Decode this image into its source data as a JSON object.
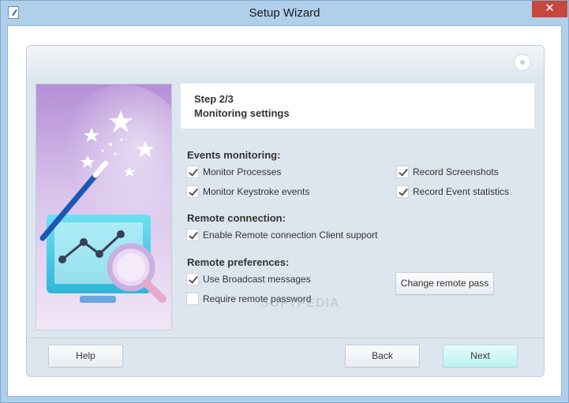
{
  "window": {
    "title": "Setup Wizard",
    "close_glyph": "✕"
  },
  "step": {
    "title": "Step 2/3",
    "subtitle": "Monitoring settings"
  },
  "events_monitoring": {
    "title": "Events monitoring:",
    "items": [
      {
        "label": "Monitor Processes",
        "checked": true
      },
      {
        "label": "Record Screenshots",
        "checked": true
      },
      {
        "label": "Monitor Keystroke events",
        "checked": true
      },
      {
        "label": "Record Event statistics",
        "checked": true
      }
    ]
  },
  "remote_connection": {
    "title": "Remote connection:",
    "items": [
      {
        "label": "Enable Remote connection Client support",
        "checked": true
      }
    ]
  },
  "remote_preferences": {
    "title": "Remote preferences:",
    "items": [
      {
        "label": "Use Broadcast messages",
        "checked": true
      },
      {
        "label": "Require remote password",
        "checked": false
      }
    ],
    "change_pass_label": "Change remote pass"
  },
  "footer": {
    "help_label": "Help",
    "back_label": "Back",
    "next_label": "Next"
  },
  "watermark": "SOFTPEDIA",
  "colors": {
    "frame": "#aed0ea",
    "close": "#c7463d",
    "panel": "#dde6ef",
    "primary_button": "#bdf2f3"
  }
}
